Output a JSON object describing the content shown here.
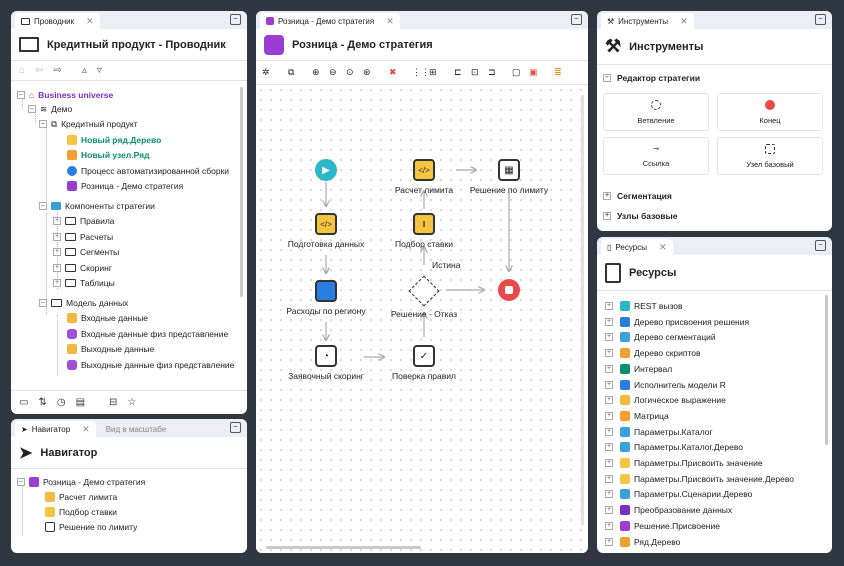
{
  "explorer": {
    "tab": "Проводник",
    "title": "Кредитный продукт - Проводник",
    "items": [
      "Business universe",
      "Демо",
      "Кредитный продукт",
      "Новый ряд.Дерево",
      "Новый узел.Ряд",
      "Процесс автоматизированной сборки",
      "Розница - Демо стратегия",
      "Компоненты стратегии",
      "Правила",
      "Расчеты",
      "Сегменты",
      "Скоринг",
      "Таблицы",
      "Модель данных",
      "Входные данные",
      "Входные данные физ представление",
      "Выходные данные",
      "Выходные данные физ представление"
    ]
  },
  "navigator": {
    "tab": "Навигатор",
    "tab2": "Вид в масштабе",
    "title": "Навигатор",
    "items": [
      "Розница - Демо стратегия",
      "Расчет лимита",
      "Подбор ставки",
      "Решение по лимиту"
    ]
  },
  "editor": {
    "tab": "Розница - Демо стратегия",
    "title": "Розница - Демо стратегия",
    "nodes": {
      "prep": "Подготовка данных",
      "region": "Расходы по региону",
      "scoring": "Заявочный скоринг",
      "limit": "Расчет лимита",
      "rate": "Подбор ставки",
      "split": "Решение - Отказ",
      "check": "Поверка правил",
      "decision": "Решение по лимиту"
    },
    "edge_label": "Истина"
  },
  "tools": {
    "tab": "Инструменты",
    "title": "Инструменты",
    "section": "Редактор стратегии",
    "cards": [
      "Ветвление",
      "Конец",
      "Ссылка",
      "Узел базовый"
    ],
    "sections": [
      "Сегментация",
      "Узлы базовые"
    ]
  },
  "resources": {
    "tab": "Ресурсы",
    "title": "Ресурсы",
    "items": [
      "REST вызов",
      "Дерево присвоения решения",
      "Дерево сегментаций",
      "Дерево скриптов",
      "Интервал",
      "Исполнитель модели R",
      "Логическое выражение",
      "Матрица",
      "Параметры.Каталог",
      "Параметры.Каталог.Дерево",
      "Параметры.Присвоить значение",
      "Параметры.Присвоить значение.Дерево",
      "Параметры.Сценарии.Дерево",
      "Преобразование данных",
      "Решение.Присвоение",
      "Ряд.Дерево"
    ]
  },
  "colors": {
    "accent": "#7b2fbf",
    "green": "#0a8f6f",
    "red": "#e84a4a",
    "teal": "#2bb8c6"
  }
}
